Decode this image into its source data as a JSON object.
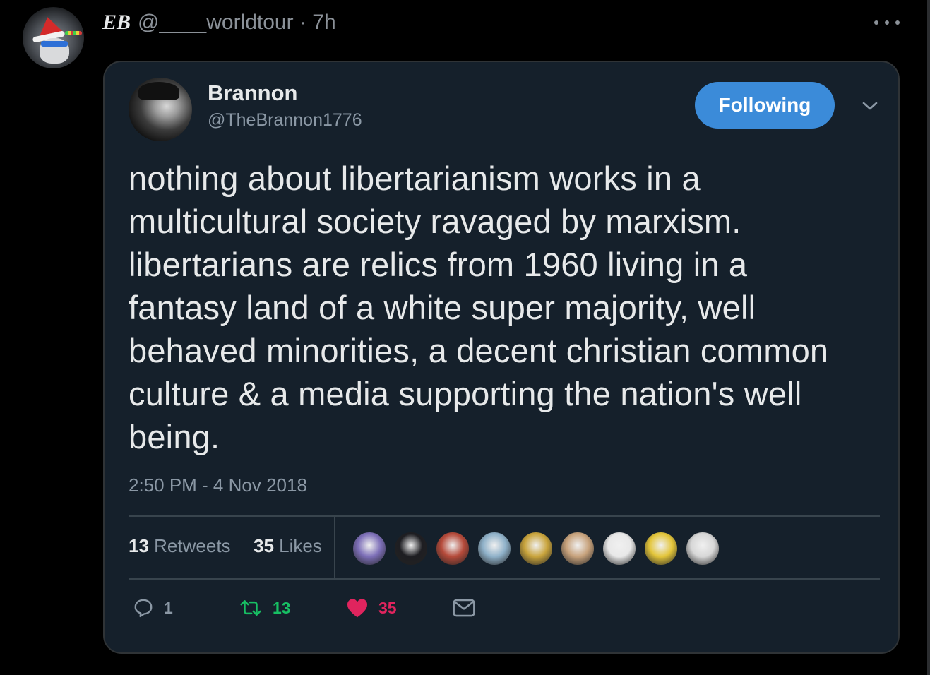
{
  "outer_tweet": {
    "display_name": "EB",
    "handle_time": "@____worldtour · 7h"
  },
  "quoted_tweet": {
    "display_name": "Brannon",
    "handle": "@TheBrannon1776",
    "follow_label": "Following",
    "text": "nothing about libertarianism works in a multicultural society ravaged by marxism. libertarians are relics from 1960 living in a fantasy land of a white super majority, well behaved minorities, a decent christian common culture & a media supporting the nation's well being.",
    "timestamp": "2:50 PM - 4 Nov 2018",
    "retweets_count": "13",
    "retweets_label": "Retweets",
    "likes_count": "35",
    "likes_label": "Likes",
    "actions": {
      "reply_count": "1",
      "retweet_count": "13",
      "like_count": "35"
    },
    "liker_avatar_colors": [
      "#7d6fb8",
      "#1e1e22",
      "#b54a3a",
      "#8fb1c9",
      "#c9a43c",
      "#c7a27c",
      "#e8e8e8",
      "#e3c53a",
      "#d7d7d7"
    ]
  },
  "colors": {
    "background": "#000000",
    "card": "#15202b",
    "accent": "#3b8bd9",
    "retweet_green": "#17bf63",
    "like_pink": "#e0245e",
    "muted": "#8b98a5"
  },
  "icons": [
    "more-icon",
    "chevron-down-icon",
    "reply-icon",
    "retweet-icon",
    "heart-icon",
    "message-icon"
  ]
}
